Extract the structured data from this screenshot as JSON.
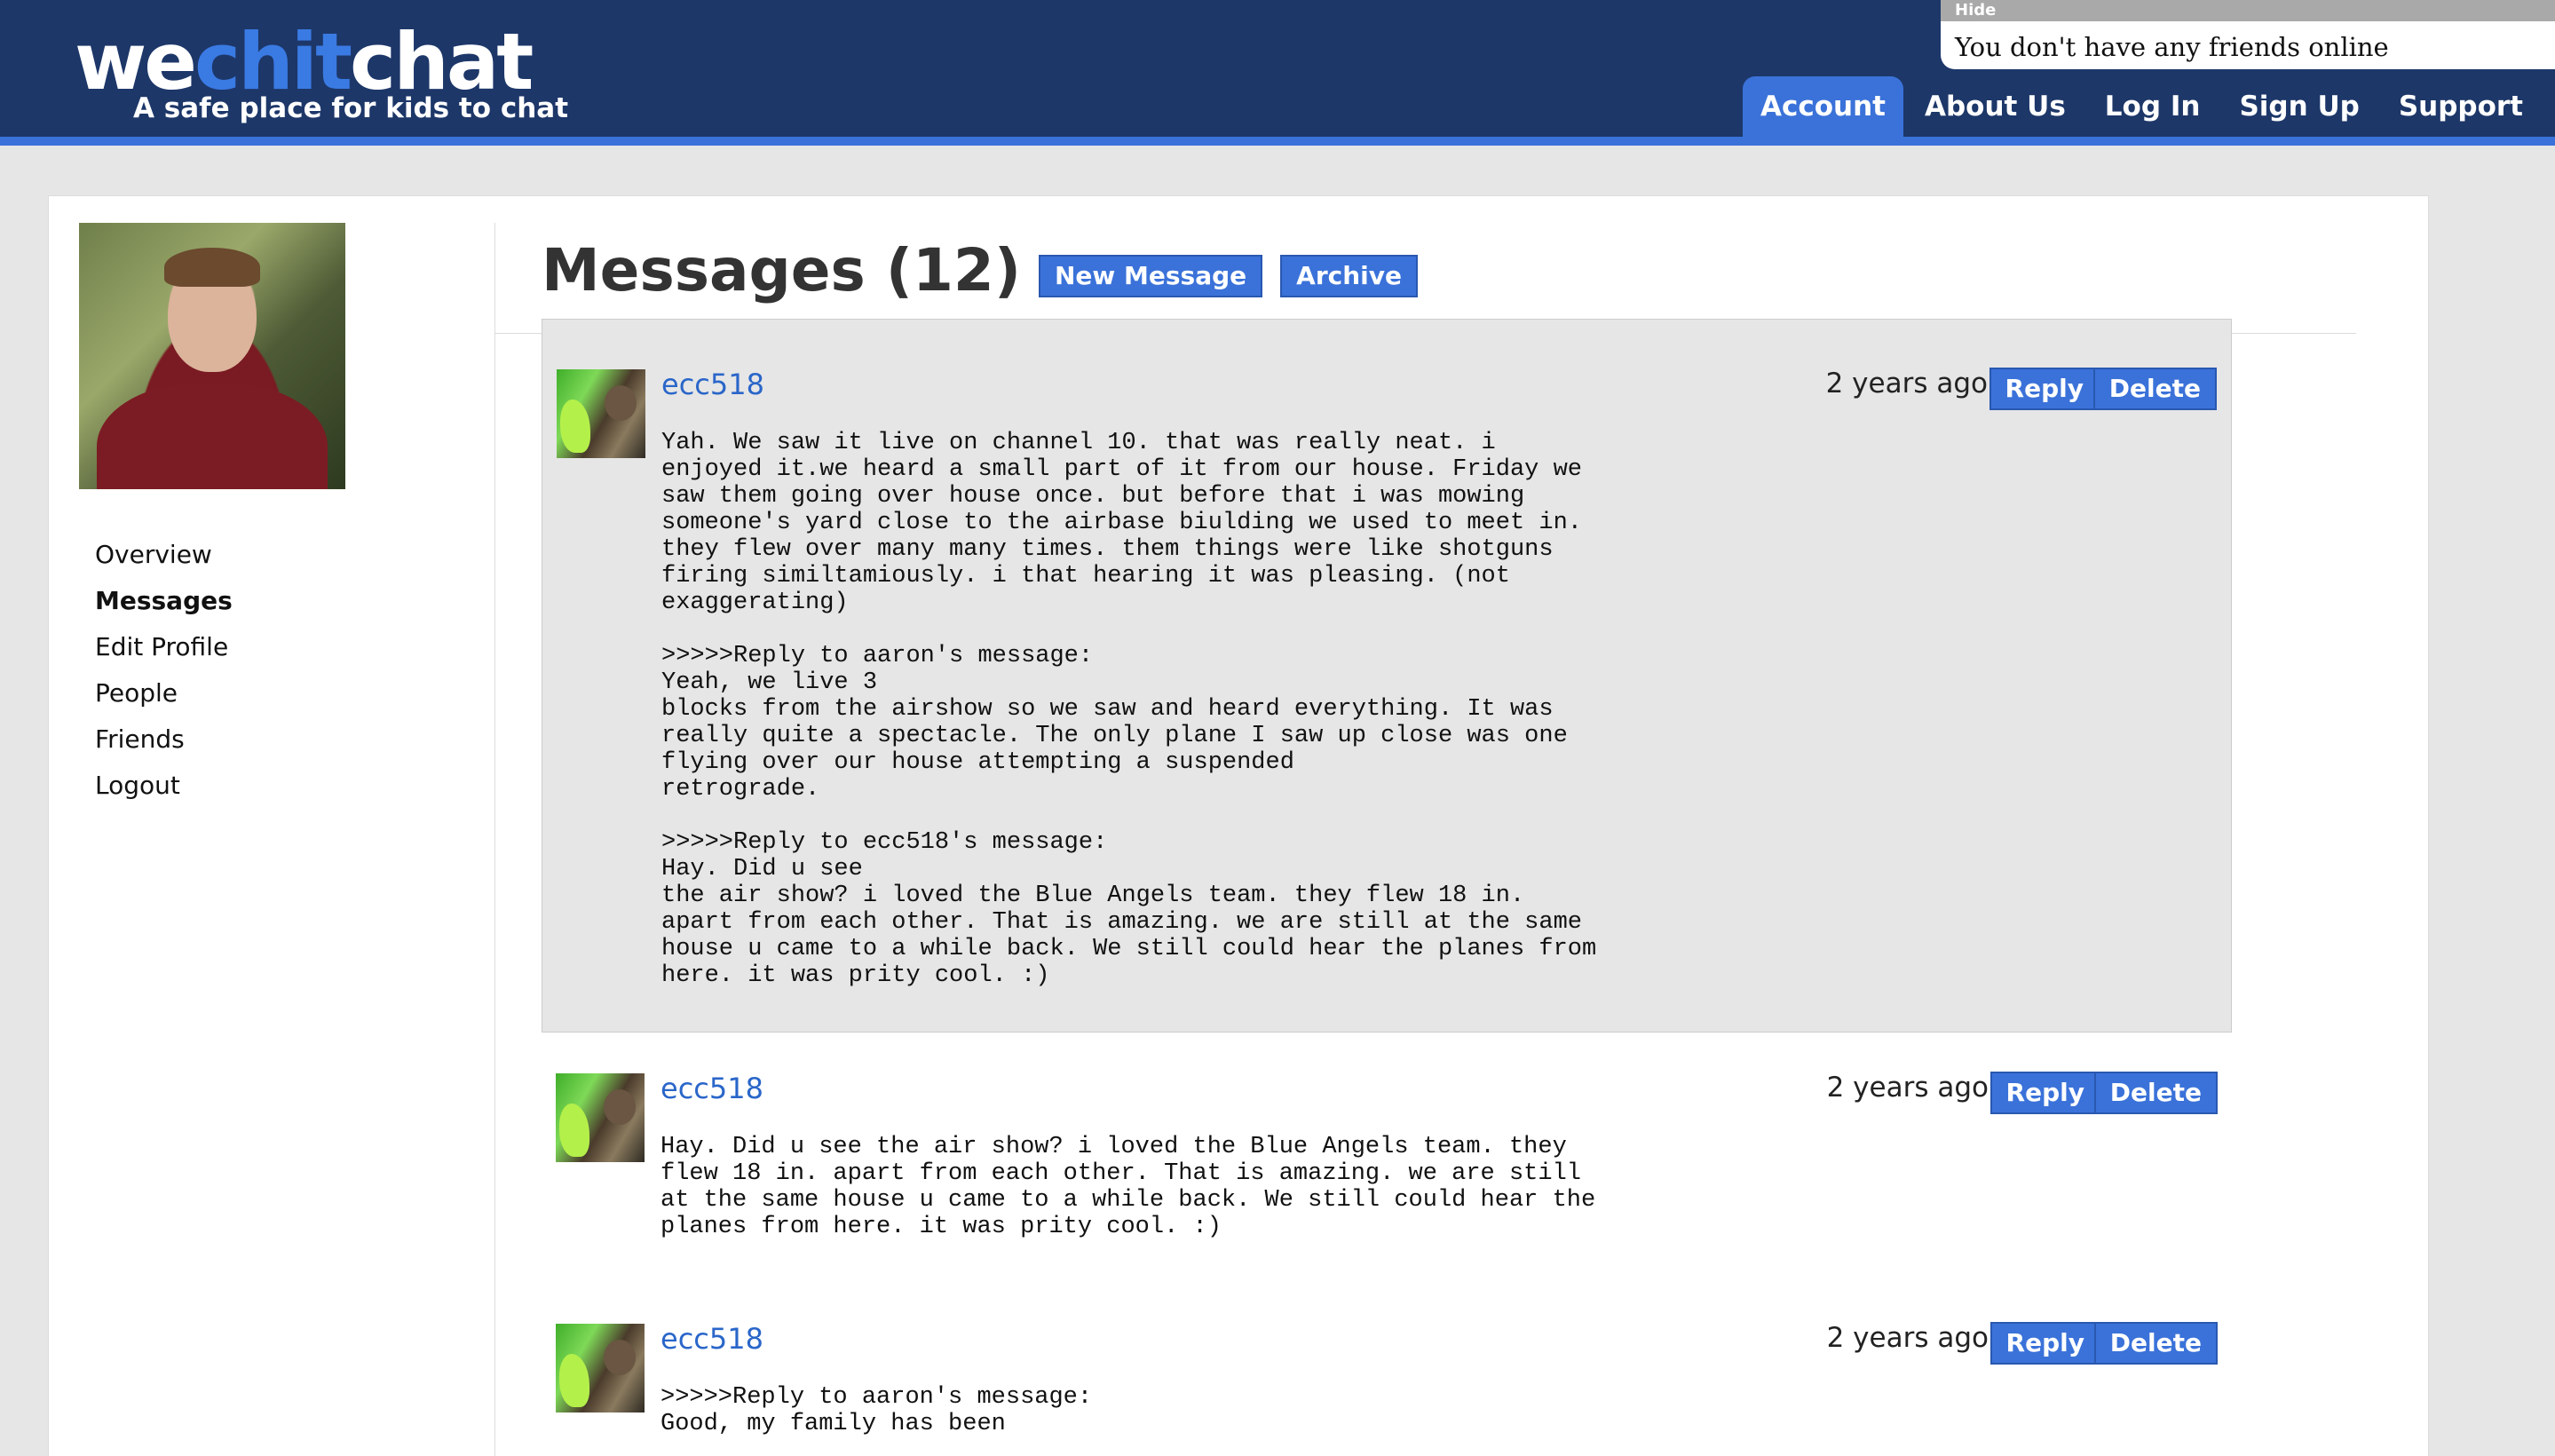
{
  "header": {
    "logo": {
      "part1": "we",
      "part2": "chit",
      "part3": "chat"
    },
    "tagline": "A safe place for kids to chat"
  },
  "friends_popup": {
    "hide_label": "Hide",
    "text": "You don't have any friends online"
  },
  "nav": {
    "items": [
      {
        "label": "Account",
        "active": true
      },
      {
        "label": "About Us",
        "active": false
      },
      {
        "label": "Log In",
        "active": false
      },
      {
        "label": "Sign Up",
        "active": false
      },
      {
        "label": "Support",
        "active": false
      }
    ]
  },
  "sidebar": {
    "items": [
      {
        "label": "Overview"
      },
      {
        "label": "Messages"
      },
      {
        "label": "Edit Profile"
      },
      {
        "label": "People"
      },
      {
        "label": "Friends"
      },
      {
        "label": "Logout"
      }
    ],
    "current": "Messages"
  },
  "main": {
    "title": "Messages (12)",
    "new_message_label": "New Message",
    "archive_label": "Archive",
    "reply_label": "Reply",
    "delete_label": "Delete"
  },
  "messages": [
    {
      "user": "ecc518",
      "time": "2 years ago",
      "body": "Yah. We saw it live on channel 10. that was really neat. i\nenjoyed it.we heard a small part of it from our house. Friday we\nsaw them going over house once. but before that i was mowing\nsomeone's yard close to the airbase biulding we used to meet in.\nthey flew over many many times. them things were like shotguns\nfiring similtamiously. i that hearing it was pleasing. (not\nexaggerating)\n\n>>>>>Reply to aaron's message:\nYeah, we live 3\nblocks from the airshow so we saw and heard everything. It was\nreally quite a spectacle. The only plane I saw up close was one\nflying over our house attempting a suspended\nretrograde.\n\n>>>>>Reply to ecc518's message:\nHay. Did u see\nthe air show? i loved the Blue Angels team. they flew 18 in.\napart from each other. That is amazing. we are still at the same\nhouse u came to a while back. We still could hear the planes from\nhere. it was prity cool. :)"
    },
    {
      "user": "ecc518",
      "time": "2 years ago",
      "body": "Hay. Did u see the air show? i loved the Blue Angels team. they\nflew 18 in. apart from each other. That is amazing. we are still\nat the same house u came to a while back. We still could hear the\nplanes from here. it was prity cool. :)"
    },
    {
      "user": "ecc518",
      "time": "2 years ago",
      "body": ">>>>>Reply to aaron's message:\nGood, my family has been"
    }
  ]
}
